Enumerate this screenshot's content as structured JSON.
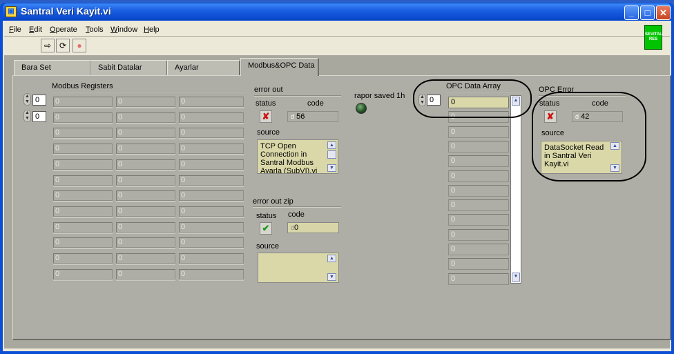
{
  "window": {
    "title": "Santral Veri Kayit.vi",
    "app_icon": "labview-vi-icon"
  },
  "menubar": [
    {
      "label": "File",
      "mnemonic": "F",
      "rest": "ile"
    },
    {
      "label": "Edit",
      "mnemonic": "E",
      "rest": "dit"
    },
    {
      "label": "Operate",
      "mnemonic": "O",
      "rest": "perate"
    },
    {
      "label": "Tools",
      "mnemonic": "T",
      "rest": "ools"
    },
    {
      "label": "Window",
      "mnemonic": "W",
      "rest": "indow"
    },
    {
      "label": "Help",
      "mnemonic": "H",
      "rest": "elp"
    }
  ],
  "toolbar": {
    "run": "⇨",
    "run_continuous": "⟳",
    "abort": "●"
  },
  "logo": {
    "line1": "SEVITALI",
    "line2": "RES"
  },
  "tabs": [
    {
      "label": "Bara Set"
    },
    {
      "label": "Sabit Datalar"
    },
    {
      "label": "Ayarlar"
    },
    {
      "label": "Modbus&OPC Data"
    }
  ],
  "active_tab": "Modbus&OPC Data",
  "modbus": {
    "title": "Modbus Registers",
    "row_index": "0",
    "col_index": "0",
    "cells": [
      [
        "0",
        "0",
        "0"
      ],
      [
        "0",
        "0",
        "0"
      ],
      [
        "0",
        "0",
        "0"
      ],
      [
        "0",
        "0",
        "0"
      ],
      [
        "0",
        "0",
        "0"
      ],
      [
        "0",
        "0",
        "0"
      ],
      [
        "0",
        "0",
        "0"
      ],
      [
        "0",
        "0",
        "0"
      ],
      [
        "0",
        "0",
        "0"
      ],
      [
        "0",
        "0",
        "0"
      ],
      [
        "0",
        "0",
        "0"
      ],
      [
        "0",
        "0",
        "0"
      ]
    ]
  },
  "error_out": {
    "title": "error out",
    "status_label": "status",
    "code_label": "code",
    "status": "✘",
    "code_prefix": "d",
    "code": "56",
    "source_label": "source",
    "source": "TCP Open Connection in Santral Modbus Ayarla (SubVI).vi"
  },
  "error_out_zip": {
    "title": "error out zip",
    "status_label": "status",
    "code_label": "code",
    "status": "✔",
    "code_prefix": "d",
    "code": "0",
    "source_label": "source",
    "source": ""
  },
  "rapor": {
    "label": "rapor saved 1h"
  },
  "opc_array": {
    "title": "OPC Data Array",
    "index": "0",
    "values": [
      "0",
      "0",
      "0",
      "0",
      "0",
      "0",
      "0",
      "0",
      "0",
      "0",
      "0",
      "0",
      "0"
    ]
  },
  "opc_error": {
    "title": "OPC Error",
    "status_label": "status",
    "code_label": "code",
    "status": "✘",
    "code_prefix": "d",
    "code": "42",
    "source_label": "source",
    "source": "DataSocket Read in Santral Veri Kayit.vi"
  },
  "colors": {
    "titlebar": "#1b5fe3",
    "panel": "#aeaea6",
    "error_red": "#cc1111",
    "ok_green": "#1a9a1a",
    "source_bg": "#dad8a8"
  }
}
